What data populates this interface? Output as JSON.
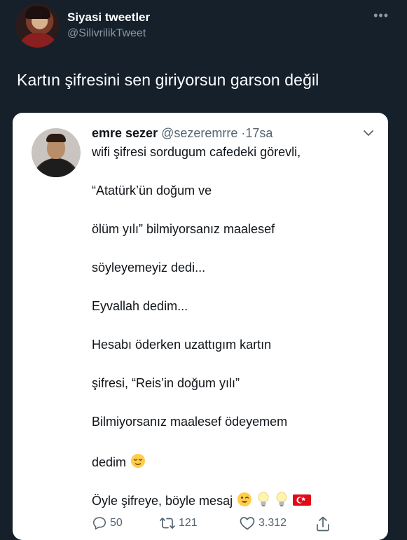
{
  "outer_tweet": {
    "display_name": "Siyasi tweetler",
    "handle": "@SilivrilikTweet",
    "text": "Kartın şifresini sen giriyorsun garson değil"
  },
  "quoted_tweet": {
    "display_name": "emre sezer",
    "handle": "@sezeremrre",
    "separator": "·",
    "time": "17sa",
    "lines": [
      "wifi şifresi sordugum cafedeki görevli,",
      "“Atatürk’ün doğum ve",
      "ölüm yılı” bilmiyorsanız maalesef",
      "söyleyemeyiz dedi...",
      "Eyvallah dedim...",
      "Hesabı öderken uzattıgım kartın",
      "şifresi, “Reis’in doğum yılı”",
      "Bilmiyorsanız maalesef ödeyemem",
      "dedim",
      "Öyle şifreye, böyle mesaj"
    ],
    "actions": {
      "reply_count": "50",
      "retweet_count": "121",
      "like_count": "3.312"
    }
  },
  "icons": {
    "more": "more-horizontal-icon",
    "caret": "chevron-down-icon",
    "reply": "reply-icon",
    "retweet": "retweet-icon",
    "like": "heart-icon",
    "share": "share-icon",
    "emojis": [
      "relieved-face-emoji",
      "winking-face-emoji",
      "light-bulb-emoji",
      "turkey-flag-emoji"
    ]
  },
  "colors": {
    "background": "#15202b",
    "card": "#ffffff",
    "secondary_text": "#8b98a5",
    "card_secondary_text": "#536471"
  }
}
